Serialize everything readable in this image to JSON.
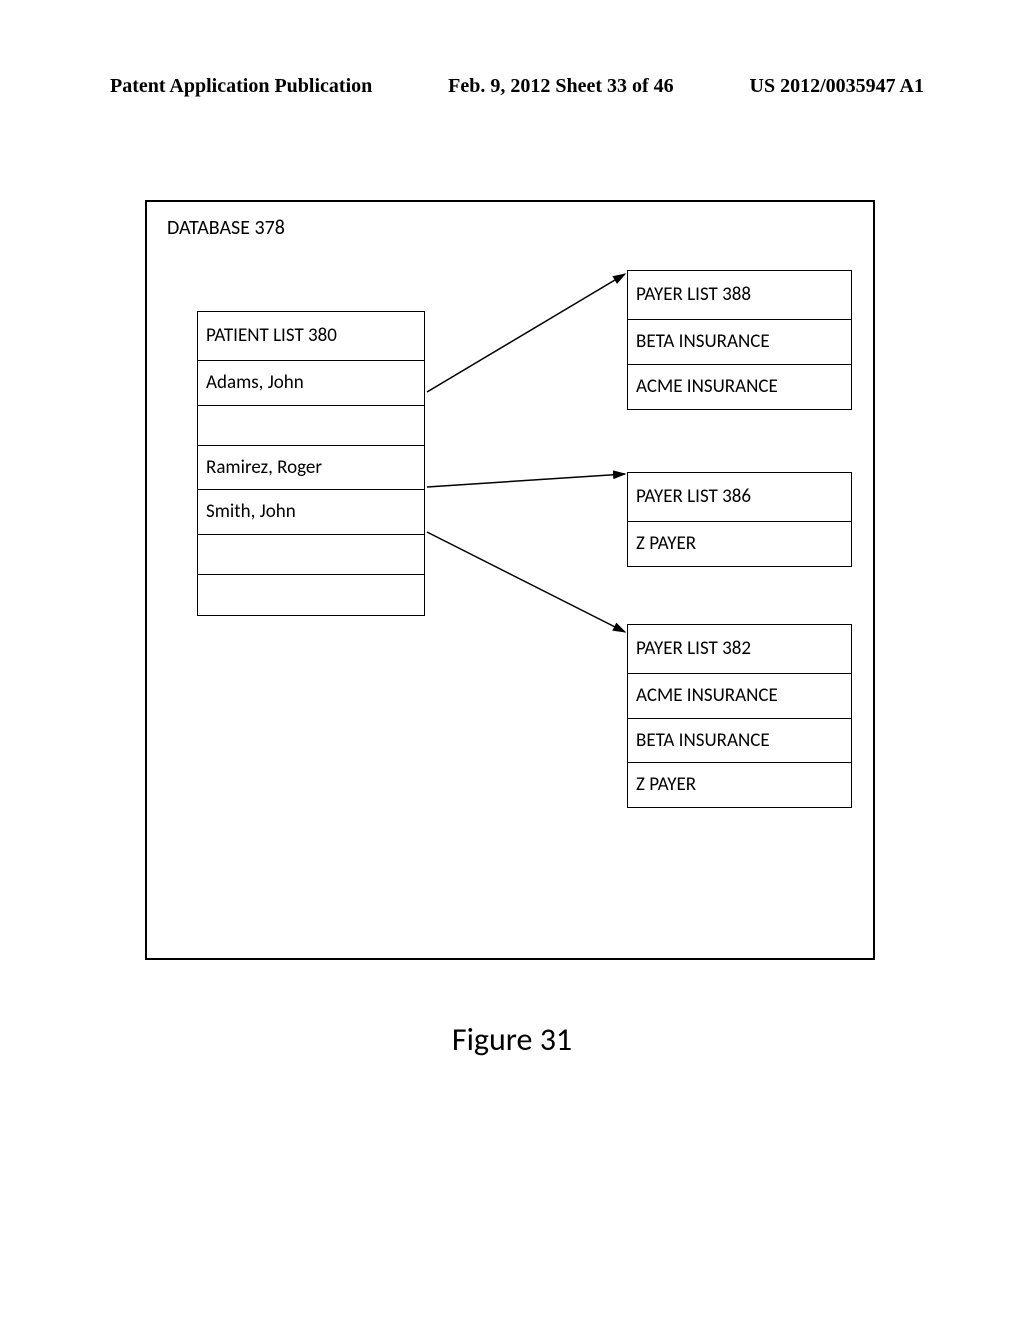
{
  "header": {
    "left": "Patent Application Publication",
    "center": "Feb. 9, 2012  Sheet 33 of 46",
    "right": "US 2012/0035947 A1"
  },
  "database": {
    "title": "DATABASE 378"
  },
  "patientList": {
    "title": "PATIENT LIST 380",
    "rows": [
      "Adams, John",
      "",
      "Ramirez, Roger",
      "Smith, John",
      "",
      ""
    ]
  },
  "payer388": {
    "title": "PAYER LIST 388",
    "rows": [
      "BETA INSURANCE",
      "ACME INSURANCE"
    ]
  },
  "payer386": {
    "title": "PAYER LIST 386",
    "rows": [
      "Z PAYER"
    ]
  },
  "payer382": {
    "title": "PAYER LIST 382",
    "rows": [
      "ACME INSURANCE",
      "BETA INSURANCE",
      "Z PAYER"
    ]
  },
  "figureCaption": "Figure 31"
}
